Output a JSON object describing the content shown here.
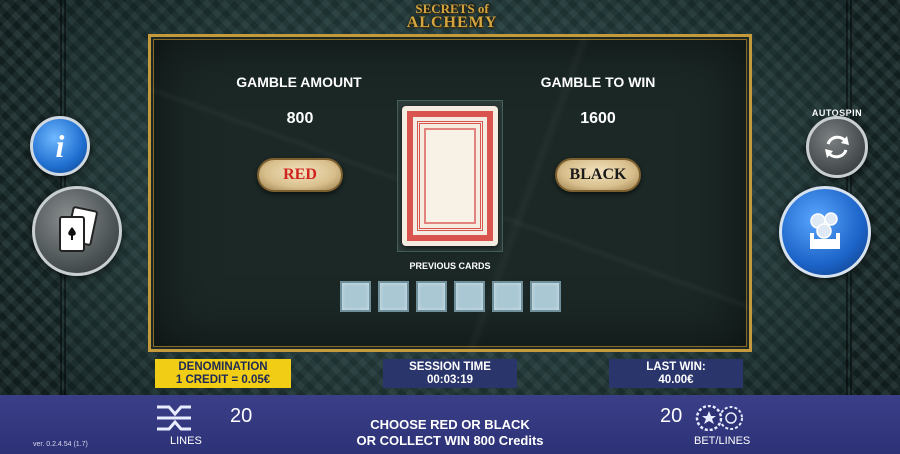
{
  "logo": {
    "line1": "ECRETS of",
    "line2": "ALCHEMY"
  },
  "gamble": {
    "amount_label": "GAMBLE AMOUNT",
    "amount_value": "800",
    "towin_label": "GAMBLE TO WIN",
    "towin_value": "1600",
    "red_label": "RED",
    "black_label": "BLACK",
    "previous_cards_label": "PREVIOUS CARDS",
    "previous_cards_count": 6
  },
  "side_buttons": {
    "autospin_label": "AUTOSPIN",
    "info_glyph": "i"
  },
  "info_bar": {
    "denomination_label": "DENOMINATION",
    "denomination_value": "1 CREDIT = 0.05€",
    "session_label": "SESSION TIME",
    "session_value": "00:03:19",
    "lastwin_label": "LAST WIN:",
    "lastwin_value": "40.00€"
  },
  "bottom": {
    "lines_value": "20",
    "lines_label": "LINES",
    "message_line1": "CHOOSE RED OR BLACK",
    "message_line2": "OR COLLECT WIN 800 Credits",
    "bet_value": "20",
    "bet_label": "BET/LINES",
    "version": "ver. 0.2.4.54 (1.7)"
  },
  "colors": {
    "red_text": "#d0241e",
    "black_text": "#1a1a1a",
    "gold_frame": "#c59a3a",
    "denom_bg": "#f2cd16",
    "bar_bg": "#2d3277"
  },
  "icons": [
    "info-icon",
    "playing-cards-icon",
    "autospin-icon",
    "coins-spin-icon",
    "lines-logo-icon",
    "chips-icon"
  ]
}
